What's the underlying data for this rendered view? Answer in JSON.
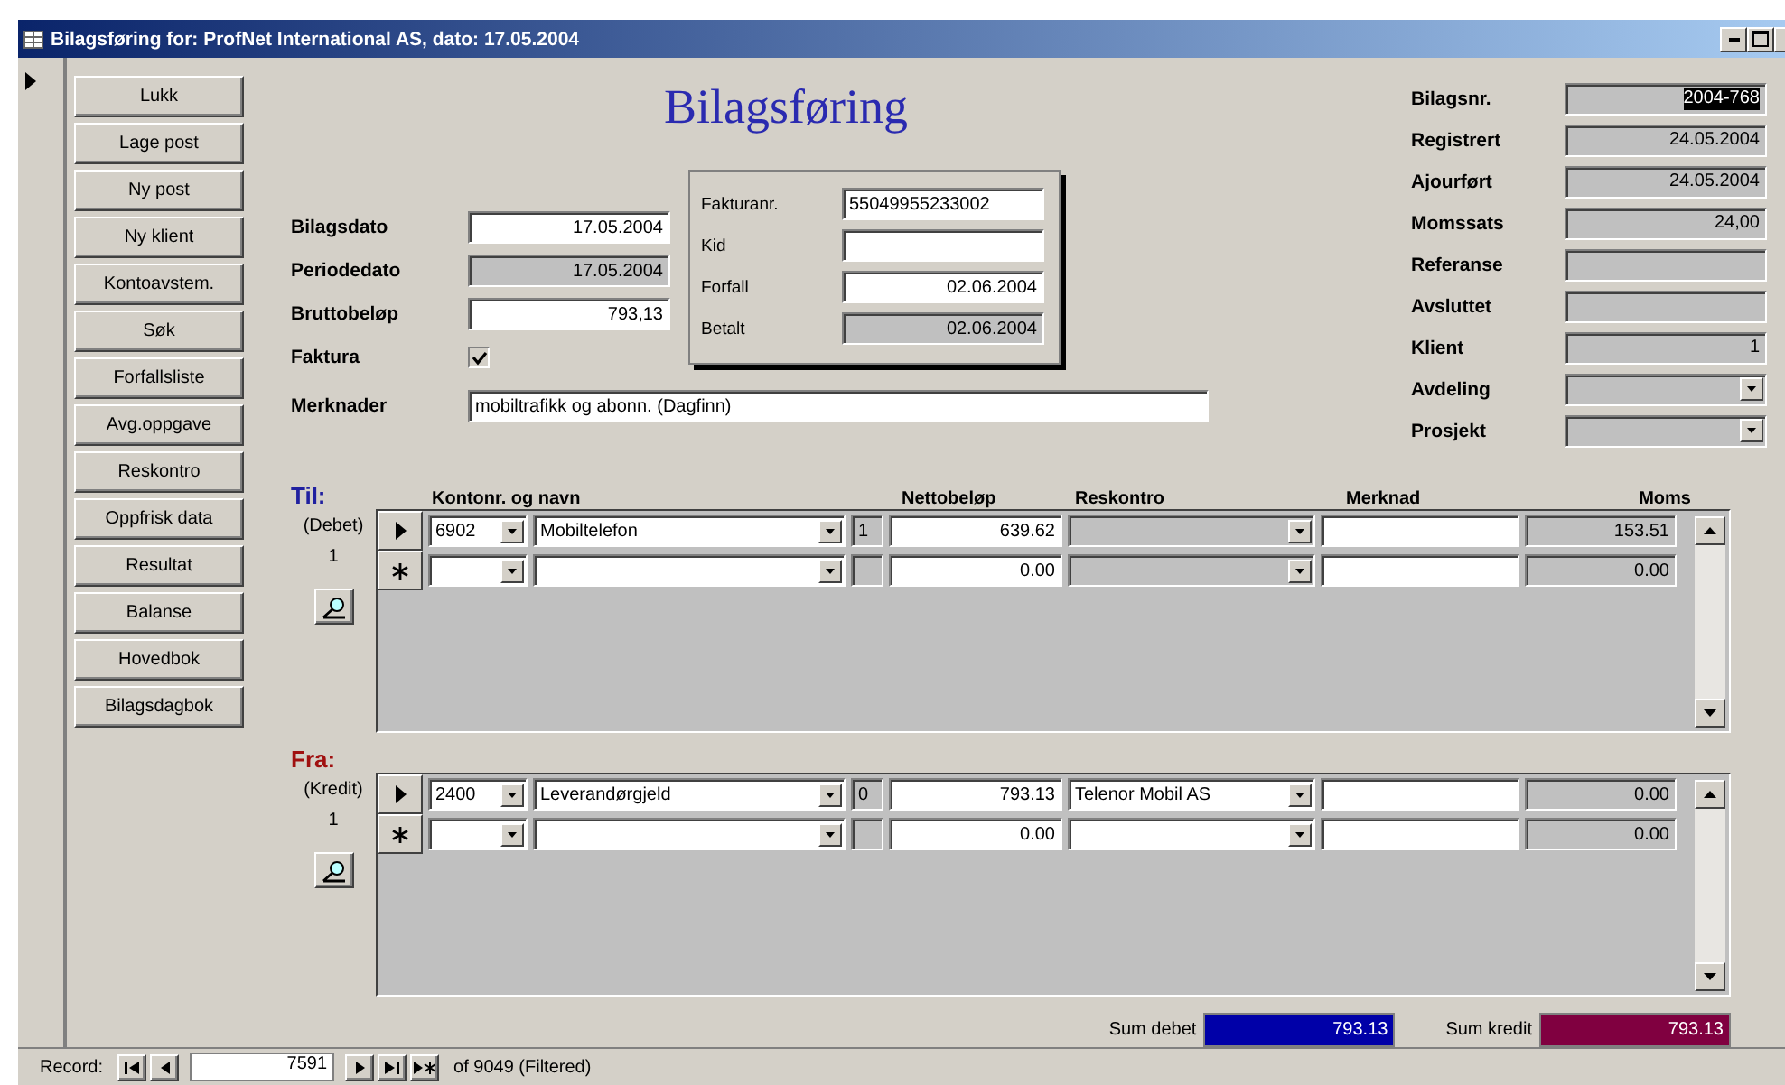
{
  "window": {
    "title": "Bilagsføring for: ProfNet International AS, dato: 17.05.2004"
  },
  "nav_buttons": [
    "Lukk",
    "Lage post",
    "Ny post",
    "Ny klient",
    "Kontoavstem.",
    "Søk",
    "Forfallsliste",
    "Avg.oppgave",
    "Reskontro",
    "Oppfrisk data",
    "Resultat",
    "Balanse",
    "Hovedbok",
    "Bilagsdagbok"
  ],
  "form_title": "Bilagsføring",
  "main_fields": [
    {
      "label": "Bilagsdato",
      "kind": "text",
      "value": "17.05.2004",
      "locked": false
    },
    {
      "label": "Periodedato",
      "kind": "text",
      "value": "17.05.2004",
      "locked": true
    },
    {
      "label": "Bruttobeløp",
      "kind": "text",
      "value": "793,13",
      "locked": false
    },
    {
      "label": "Faktura",
      "kind": "checkbox",
      "checked": true
    }
  ],
  "remarks": {
    "label": "Merknader",
    "value": "mobiltrafikk og abonn. (Dagfinn)"
  },
  "invoice_box": [
    {
      "label": "Fakturanr.",
      "value": "55049955233002",
      "locked": false,
      "kind": "text"
    },
    {
      "label": "Kid",
      "locked": false,
      "kind": "text"
    },
    {
      "label": "Forfall",
      "value": "02.06.2004",
      "locked": false,
      "kind": "date"
    },
    {
      "label": "Betalt",
      "value": "02.06.2004",
      "locked": true,
      "kind": "date"
    }
  ],
  "info_fields": [
    {
      "label": "Bilagsnr.",
      "kind": "text",
      "value": "2004-768",
      "selected": true
    },
    {
      "label": "Registrert",
      "kind": "text",
      "value": "24.05.2004",
      "selected": false
    },
    {
      "label": "Ajourført",
      "kind": "text",
      "value": "24.05.2004",
      "selected": false
    },
    {
      "label": "Momssats",
      "kind": "text",
      "value": "24,00",
      "selected": false
    },
    {
      "label": "Referanse",
      "kind": "text",
      "selected": false
    },
    {
      "label": "Avsluttet",
      "kind": "text",
      "selected": false
    },
    {
      "label": "Klient",
      "kind": "text",
      "value": "1",
      "selected": false
    },
    {
      "label": "Avdeling",
      "kind": "combo",
      "selected": false
    },
    {
      "label": "Prosjekt",
      "kind": "combo",
      "selected": false
    }
  ],
  "columns": [
    "Kontonr. og navn",
    "Nettobeløp",
    "Reskontro",
    "Merknad",
    "Moms"
  ],
  "subforms": [
    {
      "heading": "Til:",
      "color": "#2020a0",
      "side_label": "(Debet)",
      "count": "1",
      "rows": [
        {
          "kind": "current",
          "account": "6902",
          "name": "Mobiltelefon",
          "code": "1",
          "net": "639.62",
          "ledger_locked": true,
          "vat": "153.51"
        },
        {
          "kind": "new",
          "net": "0.00",
          "ledger_locked": true,
          "vat": "0.00"
        }
      ]
    },
    {
      "heading": "Fra:",
      "color": "#a01010",
      "side_label": "(Kredit)",
      "count": "1",
      "rows": [
        {
          "kind": "current",
          "account": "2400",
          "name": "Leverandørgjeld",
          "code": "0",
          "net": "793.13",
          "ledger": "Telenor Mobil AS",
          "ledger_locked": false,
          "vat": "0.00"
        },
        {
          "kind": "new",
          "net": "0.00",
          "ledger_locked": false,
          "vat": "0.00"
        }
      ]
    }
  ],
  "totals": [
    {
      "label": "Sum debet",
      "value": "793.13",
      "color": "#0000a8"
    },
    {
      "label": "Sum kredit",
      "value": "793.13",
      "color": "#800040"
    }
  ],
  "record_nav": {
    "label": "Record:",
    "current": "7591",
    "total": "of 9049 (Filtered)"
  }
}
